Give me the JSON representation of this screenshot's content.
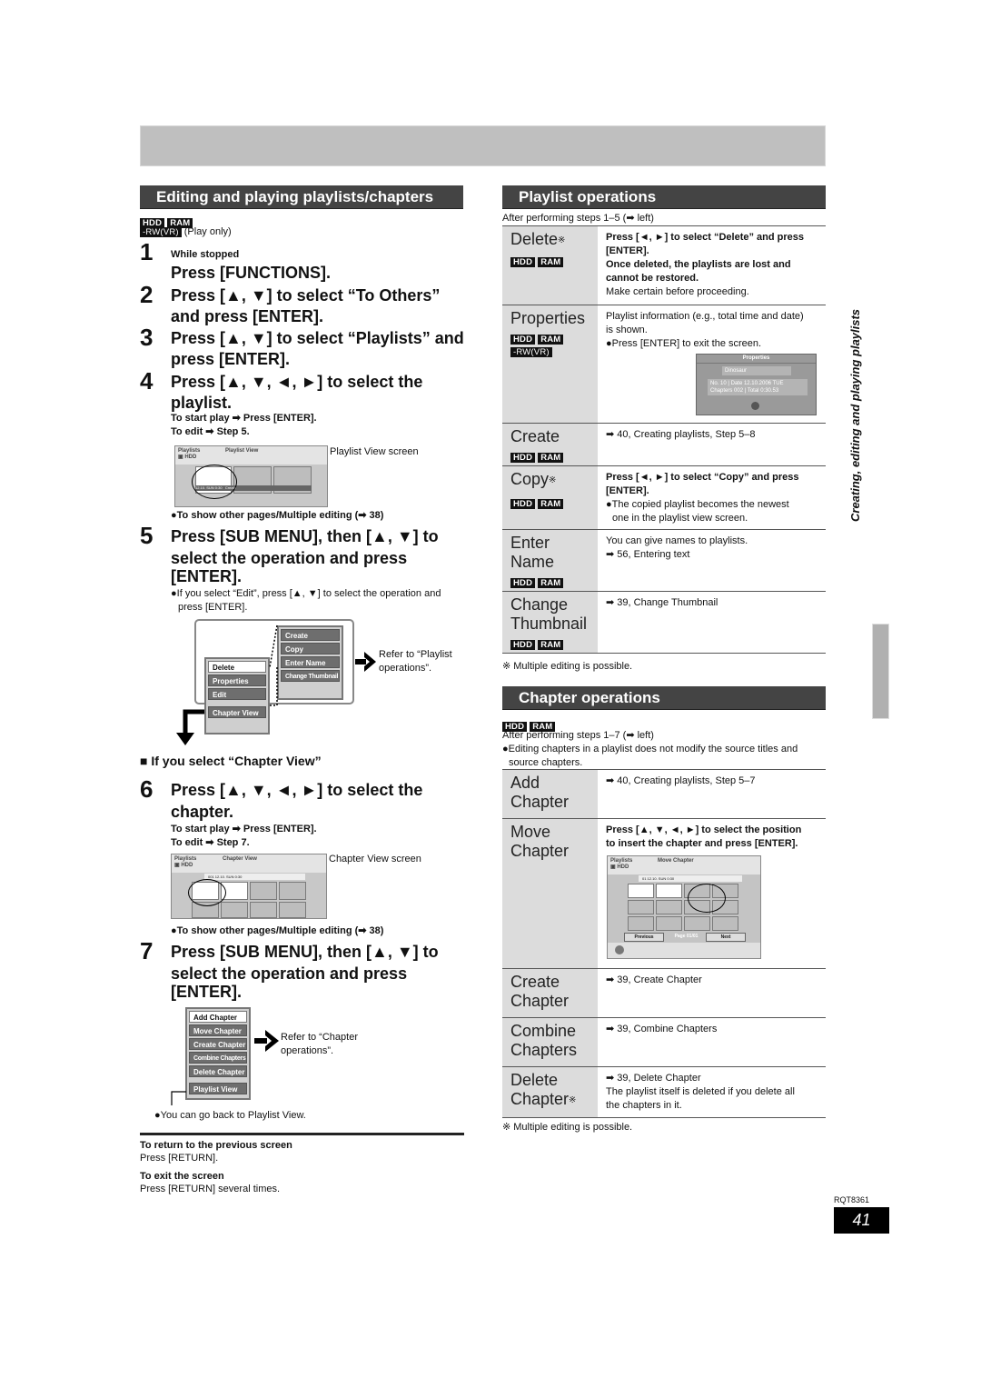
{
  "page": {
    "side_title": "Creating, editing and playing playlists",
    "doc_code": "RQT8361",
    "page_number": "41"
  },
  "left": {
    "section_title": "Editing and playing playlists/chapters",
    "badges": [
      "HDD",
      "RAM"
    ],
    "badge_rw": "-RW(VR)",
    "play_only": "(Play only)",
    "steps": [
      {
        "num": "1",
        "pre": "While stopped",
        "lines": [
          "Press [FUNCTIONS]."
        ]
      },
      {
        "num": "2",
        "lines": [
          "Press [▲, ▼] to select “To Others”",
          "and press [ENTER]."
        ]
      },
      {
        "num": "3",
        "lines": [
          "Press [▲, ▼] to select “Playlists” and",
          "press [ENTER]."
        ]
      },
      {
        "num": "4",
        "lines": [
          "Press [▲, ▼, ◄, ►] to select the",
          "playlist."
        ],
        "subs": [
          "To start play ➡ Press [ENTER].",
          "To edit ➡ Step 5."
        ]
      },
      {
        "num": "5",
        "lines": [
          "Press [SUB MENU], then [▲, ▼] to",
          "select the operation and press",
          "[ENTER]."
        ],
        "note": "●If you select “Edit”, press [▲, ▼] to select the operation and",
        "note2": "press [ENTER]."
      },
      {
        "num": "6",
        "lines": [
          "Press [▲, ▼, ◄, ►] to select the",
          "chapter."
        ],
        "subs": [
          "To start play ➡ Press [ENTER].",
          "To edit ➡ Step 7."
        ]
      },
      {
        "num": "7",
        "lines": [
          "Press [SUB MENU], then [▲, ▼] to",
          "select the operation and press",
          "[ENTER]."
        ]
      }
    ],
    "playlist_screen": {
      "caption": "Playlist View screen",
      "hdr_left": "Playlists",
      "hdr_title": "Playlist View",
      "drive": "HDD",
      "cell_label": "12.10. SUN 0:30",
      "cell_label2": "Create"
    },
    "other_pages_note_1": "●To show other pages/Multiple editing (➡ 38)",
    "submenu": {
      "left_items": [
        "Delete",
        "Properties",
        "Edit"
      ],
      "chapter_view": "Chapter View",
      "right_items": [
        "Create",
        "Copy",
        "Enter Name",
        "Change Thumbnail"
      ],
      "refer": [
        "Refer to “Playlist",
        "operations”."
      ]
    },
    "chapter_view_heading": "■ If you select “Chapter View”",
    "chapter_screen": {
      "caption": "Chapter View screen",
      "hdr_left": "Playlists",
      "hdr_title": "Chapter View",
      "drive": "HDD",
      "info": "001 12.10. SUN 0:30"
    },
    "other_pages_note_2": "●To show other pages/Multiple editing (➡ 38)",
    "chapter_menu": {
      "items": [
        "Add Chapter",
        "Move Chapter",
        "Create Chapter",
        "Combine Chapters",
        "Delete Chapter"
      ],
      "playlist_view": "Playlist View",
      "refer": [
        "Refer to “Chapter",
        "operations”."
      ]
    },
    "back_note": "●You can go back to Playlist View.",
    "return_title": "To return to the previous screen",
    "return_text": "Press [RETURN].",
    "exit_title": "To exit the screen",
    "exit_text": "Press [RETURN] several times."
  },
  "playlist_ops": {
    "title": "Playlist operations",
    "intro": "After performing steps 1–5 (➡ left)",
    "rows": [
      {
        "name": "Delete",
        "ast": true,
        "badges": [
          "HDD",
          "RAM"
        ],
        "bold": [
          "Press [◄, ►] to select “Delete” and press",
          "[ENTER].",
          "Once deleted, the playlists are lost and",
          "cannot be restored."
        ],
        "text": [
          "Make certain before proceeding."
        ]
      },
      {
        "name": "Properties",
        "badges": [
          "HDD",
          "RAM",
          "-RW(VR)"
        ],
        "text": [
          "Playlist information (e.g., total time and date)",
          "is shown.",
          "●Press [ENTER] to exit the screen."
        ]
      },
      {
        "name": "Create",
        "badges": [
          "HDD",
          "RAM"
        ],
        "text": [
          "➡ 40, Creating playlists, Step 5–8"
        ]
      },
      {
        "name": "Copy",
        "ast": true,
        "badges": [
          "HDD",
          "RAM"
        ],
        "bold": [
          "Press [◄, ►] to select “Copy” and press",
          "[ENTER]."
        ],
        "text": [
          "●The copied playlist becomes the newest",
          "  one in the playlist view screen."
        ]
      },
      {
        "name": "Enter Name",
        "name_lines": [
          "Enter",
          "Name"
        ],
        "badges": [
          "HDD",
          "RAM"
        ],
        "text": [
          "You can give names to playlists.",
          "➡ 56, Entering text"
        ]
      },
      {
        "name": "Change Thumbnail",
        "name_lines": [
          "Change",
          "Thumbnail"
        ],
        "badges": [
          "HDD",
          "RAM"
        ],
        "text": [
          "➡ 39, Change Thumbnail"
        ]
      }
    ],
    "properties_screen": {
      "title": "Properties",
      "name": "Dinosaur",
      "no_label": "No.",
      "no_value": "10",
      "chapters_label": "Chapters",
      "chapters_value": "002",
      "date_label": "Date",
      "date_value": "12.10.2006 TUE",
      "total_label": "Total",
      "total_value": "0:30.53"
    },
    "footnote": "※ Multiple editing is possible."
  },
  "chapter_ops": {
    "title": "Chapter operations",
    "badges": [
      "HDD",
      "RAM"
    ],
    "intro": "After performing steps 1–7 (➡ left)",
    "note": [
      "●Editing chapters in a playlist does not modify the source titles and",
      "  source chapters."
    ],
    "rows": [
      {
        "name_lines": [
          "Add",
          "Chapter"
        ],
        "text": [
          "➡ 40, Creating playlists, Step 5–7"
        ]
      },
      {
        "name_lines": [
          "Move",
          "Chapter"
        ],
        "bold": [
          "Press [▲, ▼, ◄, ►] to select the position",
          "to insert the chapter and press [ENTER]."
        ]
      },
      {
        "name_lines": [
          "Create",
          "Chapter"
        ],
        "text": [
          "➡ 39, Create Chapter"
        ]
      },
      {
        "name_lines": [
          "Combine",
          "Chapters"
        ],
        "text": [
          "➡ 39, Combine Chapters"
        ]
      },
      {
        "name_lines": [
          "Delete",
          "Chapter"
        ],
        "ast": true,
        "text": [
          "➡ 39, Delete Chapter",
          "The playlist itself is deleted if you delete all",
          "the chapters in it."
        ]
      }
    ],
    "move_screen": {
      "hdr_left": "Playlists",
      "hdr_title": "Move Chapter",
      "drive": "HDD",
      "info": "01 12.10. SUN 0:30",
      "prev": "Previous",
      "page": "Page 01/01",
      "next": "Next"
    },
    "footnote": "※ Multiple editing is possible."
  }
}
